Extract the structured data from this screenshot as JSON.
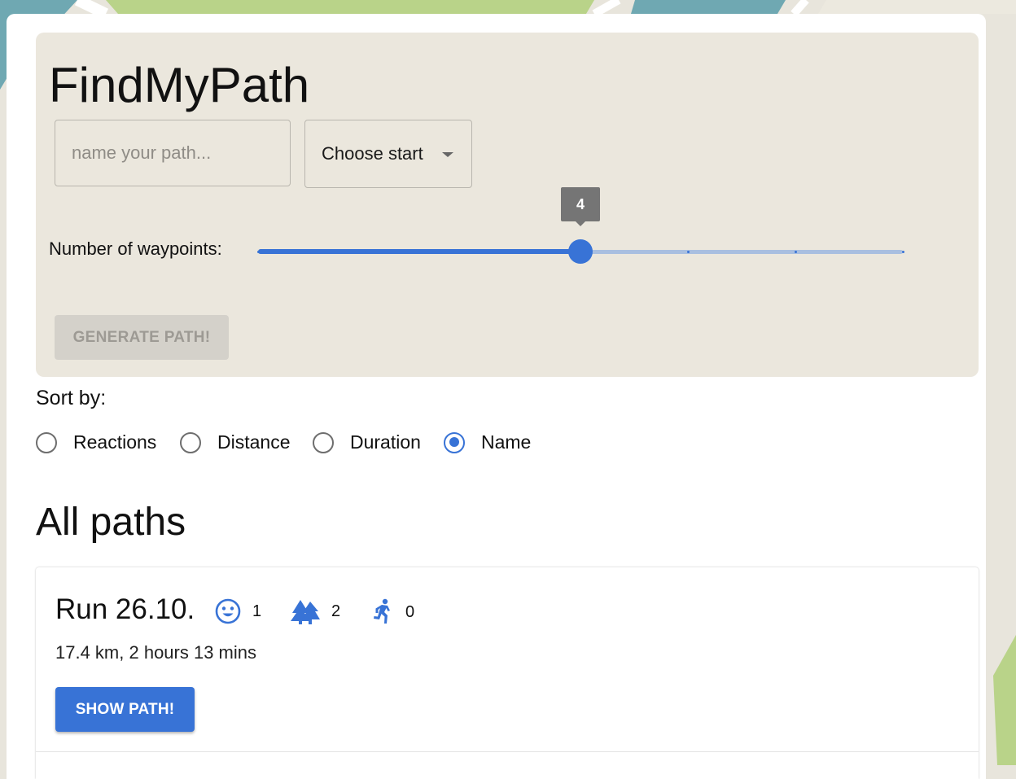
{
  "app": {
    "title": "FindMyPath"
  },
  "form": {
    "name_placeholder": "name your path...",
    "name_value": "",
    "start_select_label": "Choose start",
    "waypoints_label": "Number of waypoints:",
    "waypoints_value": "4",
    "waypoints_min": 1,
    "waypoints_max": 7,
    "waypoints_steps": [
      1,
      2,
      3,
      4,
      5,
      6,
      7
    ],
    "generate_button": "GENERATE PATH!"
  },
  "sort": {
    "label": "Sort by:",
    "options": [
      "Reactions",
      "Distance",
      "Duration",
      "Name"
    ],
    "selected": "Name"
  },
  "paths_section": {
    "title": "All paths",
    "items": [
      {
        "name": "Run 26.10.",
        "stats": [
          {
            "icon": "smiley-icon",
            "count": "1"
          },
          {
            "icon": "trees-icon",
            "count": "2"
          },
          {
            "icon": "runner-icon",
            "count": "0"
          }
        ],
        "summary": "17.4 km, 2 hours 13 mins",
        "button": "SHOW PATH!"
      }
    ]
  },
  "colors": {
    "accent": "#3873d6",
    "card_bg": "#ebe7dd",
    "disabled_button": "#d4d1ca",
    "map_green": "#b9d389",
    "map_teal": "#6fa8b2",
    "map_bg": "#e8e5dc"
  }
}
